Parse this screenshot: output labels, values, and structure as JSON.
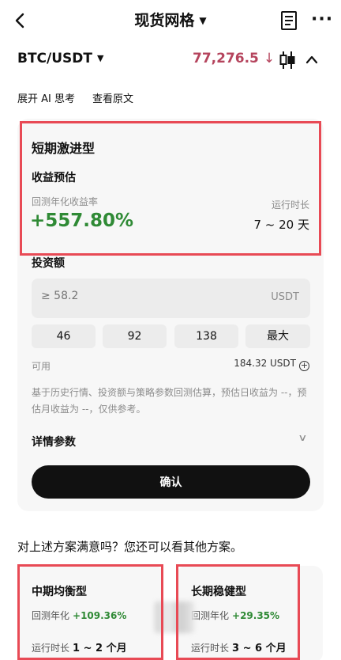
{
  "header": {
    "title": "现货网格",
    "back_icon": "back-arrow-icon",
    "menu_icon": "document-icon",
    "more_icon": "more-icon"
  },
  "pair": {
    "symbol": "BTC/USDT",
    "price": "77,276.5",
    "price_direction": "↓",
    "price_color": "#b5445d"
  },
  "links": {
    "ai_think": "展开 AI 思考",
    "view_original": "查看原文"
  },
  "strategy": {
    "name": "短期激进型",
    "yield_title": "收益预估",
    "apy_label": "回测年化收益率",
    "apy_value": "+557.80%",
    "run_label": "运行时长",
    "run_value": "7 ~ 20 天"
  },
  "investment": {
    "label": "投资额",
    "placeholder": "≥ 58.2",
    "unit": "USDT",
    "quick_amounts": [
      "46",
      "92",
      "138",
      "最大"
    ],
    "available_label": "可用",
    "available_value": "184.32 USDT"
  },
  "note": "基于历史行情、投资额与策略参数回测估算，预估日收益为 --，预估月收益为 --，仅供参考。",
  "details_label": "详情参数",
  "confirm_label": "确认",
  "question": "对上述方案满意吗？您还可以看其他方案。",
  "plans": [
    {
      "name": "中期均衡型",
      "apy_label": "回测年化",
      "apy_value": "+109.36%",
      "run_label": "运行时长",
      "run_value": "1 ~ 2 个月"
    },
    {
      "name": "长期稳健型",
      "apy_label": "回测年化",
      "apy_value": "+29.35%",
      "run_label": "运行时长",
      "run_value": "3 ~ 6 个月"
    }
  ],
  "colors": {
    "positive": "#2f8a35",
    "highlight_box": "#e84a55",
    "button": "#111111"
  }
}
